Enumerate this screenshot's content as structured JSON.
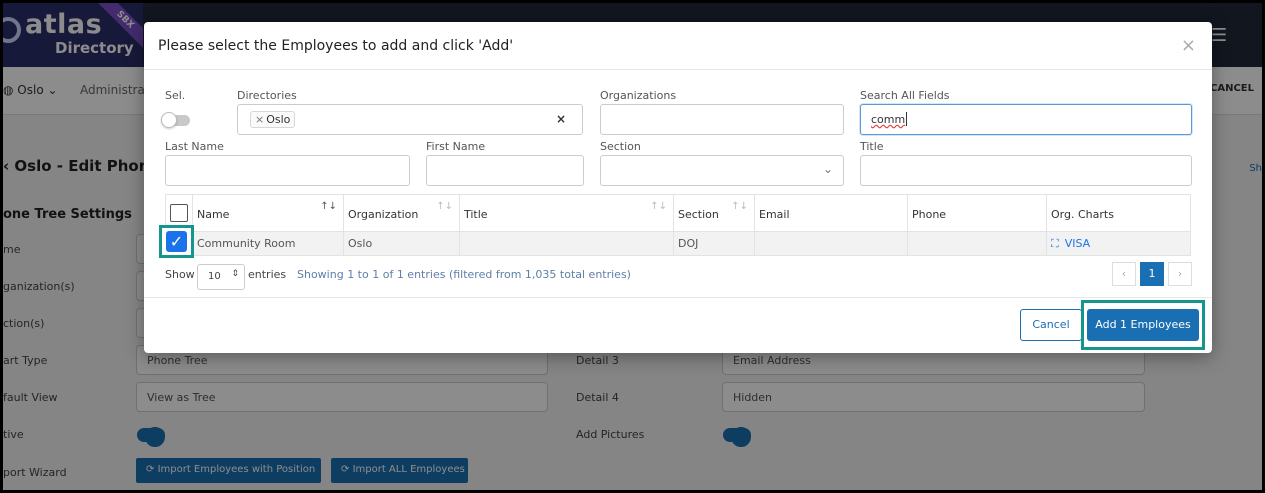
{
  "app": {
    "logo_text": "atlas",
    "logo_sub": "Directory",
    "env_badge": "SBX",
    "nav": {
      "location": "Oslo",
      "admin": "Administrat",
      "cancel": "CANCEL"
    },
    "page_title": "Oslo - Edit Phone",
    "page_show": "Sh",
    "section_title": "one Tree Settings",
    "left_labels": [
      "me",
      "ganization(s)",
      "ction(s)",
      "art Type",
      "fault View",
      "tive",
      "port Wizard"
    ],
    "chart_type_value": "Phone Tree",
    "default_view_value": "View as Tree",
    "right_labels": [
      "Detail 3",
      "Detail 4",
      "Add Pictures"
    ],
    "detail3_value": "Email Address",
    "detail4_value": "Hidden",
    "import_position_btn": "Import Employees with Position",
    "import_all_btn": "Import ALL Employees"
  },
  "modal": {
    "title": "Please select the Employees to add and click 'Add'",
    "close_glyph": "×",
    "filters": {
      "sel_label": "Sel.",
      "directories_label": "Directories",
      "directories_tag": "Oslo",
      "organizations_label": "Organizations",
      "organizations_value": "",
      "search_label": "Search All Fields",
      "search_value": "comm",
      "last_name_label": "Last Name",
      "first_name_label": "First Name",
      "section_label": "Section",
      "title_label": "Title"
    },
    "table": {
      "columns": [
        "Name",
        "Organization",
        "Title",
        "Section",
        "Email",
        "Phone",
        "Org. Charts"
      ],
      "rows": [
        {
          "name": "Community Room",
          "organization": "Oslo",
          "title": "",
          "section": "DOJ",
          "email": "",
          "phone": "",
          "org_chart": "VISA",
          "selected": true
        }
      ]
    },
    "paging": {
      "show_label": "Show",
      "page_length": "10",
      "entries_label": "entries",
      "info": "Showing 1 to 1 of 1 entries (filtered from 1,035 total entries)",
      "prev": "‹",
      "current_page": "1",
      "next": "›"
    },
    "footer": {
      "cancel_label": "Cancel",
      "add_label": "Add 1 Employees"
    }
  },
  "colors": {
    "primary": "#1a6fb3",
    "highlight": "#14968c",
    "checkbox": "#1a73e8"
  }
}
